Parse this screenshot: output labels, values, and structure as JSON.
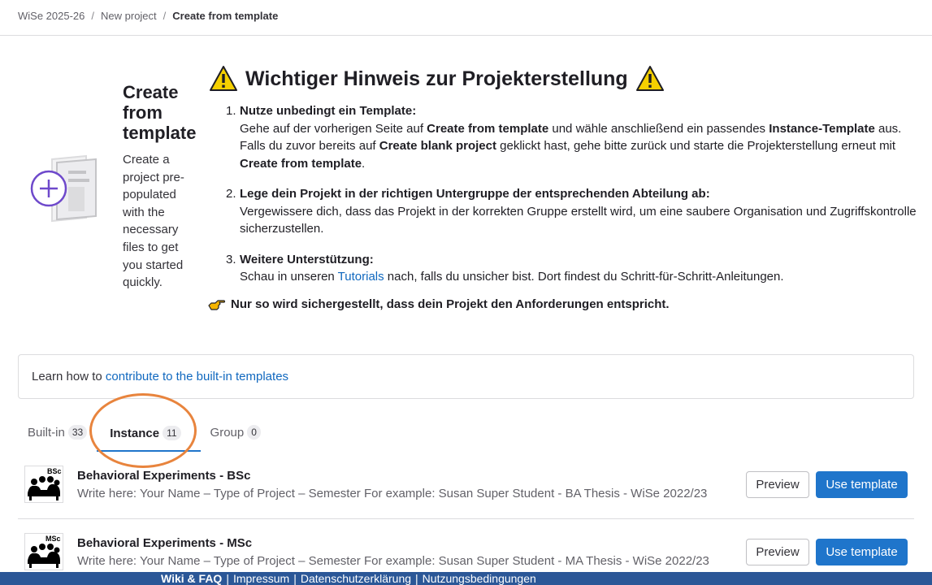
{
  "breadcrumb": {
    "items": [
      "WiSe 2025-26",
      "New project"
    ],
    "separator": "/",
    "current": "Create from template"
  },
  "side": {
    "title": "Create from template",
    "description": "Create a project pre-populated with the necessary files to get you started quickly."
  },
  "notice": {
    "title": "Wichtiger Hinweis zur Projekterstellung",
    "steps": [
      {
        "num": "1.",
        "heading": "Nutze unbedingt ein Template:",
        "p1_before": "Gehe auf der vorherigen Seite auf ",
        "p1_bold": "Create from template",
        "p1_mid": " und wähle anschließend ein passendes ",
        "p1_bold2": "Instance-Template",
        "p1_after": " aus. Falls du zuvor bereits auf ",
        "p1_bold3": "Create blank project",
        "p1_after2": " geklickt hast, gehe bitte zurück und starte die Projekterstellung erneut mit ",
        "p1_bold4": "Create from template",
        "p1_end": "."
      },
      {
        "num": "2.",
        "heading": "Lege dein Projekt in der richtigen Untergruppe der entsprechenden Abteilung ab:",
        "text": "Vergewissere dich, dass das Projekt in der korrekten Gruppe erstellt wird, um eine saubere Organisation und Zugriffskontrolle sicherzustellen."
      },
      {
        "num": "3.",
        "heading": "Weitere Unterstützung:",
        "text_before": "Schau in unseren ",
        "link": "Tutorials",
        "text_after": " nach, falls du unsicher bist. Dort findest du Schritt-für-Schritt-Anleitungen."
      }
    ],
    "final": "Nur so wird sichergestellt, dass dein Projekt den Anforderungen entspricht."
  },
  "contrib": {
    "text": "Learn how to ",
    "link": "contribute to the built-in templates"
  },
  "tabs": [
    {
      "label": "Built-in",
      "count": "33"
    },
    {
      "label": "Instance",
      "count": "11"
    },
    {
      "label": "Group",
      "count": "0"
    }
  ],
  "templates": [
    {
      "badge": "BSc",
      "name": "Behavioral Experiments - BSc",
      "description": "Write here: Your Name – Type of Project – Semester For example: Susan Super Student - BA Thesis - WiSe 2022/23",
      "preview": "Preview",
      "use": "Use template"
    },
    {
      "badge": "MSc",
      "name": "Behavioral Experiments - MSc",
      "description": "Write here: Your Name – Type of Project – Semester For example: Susan Super Student - MA Thesis - WiSe 2022/23",
      "preview": "Preview",
      "use": "Use template"
    }
  ],
  "footer": {
    "links": [
      "Wiki & FAQ",
      "Impressum",
      "Datenschutzerklärung",
      "Nutzungsbedingungen"
    ],
    "separator": "|"
  },
  "colors": {
    "accent": "#1f75cb",
    "link": "#1068bf",
    "highlight": "#e8843d",
    "footer": "#2b5797",
    "warning": "#f5d000"
  }
}
